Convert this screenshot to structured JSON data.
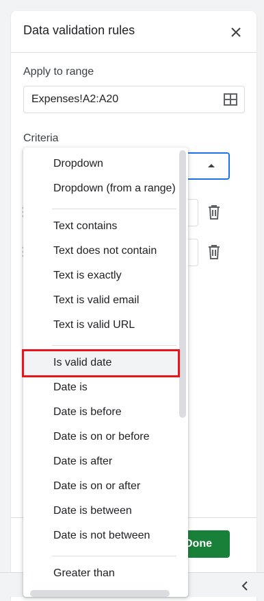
{
  "panel": {
    "title": "Data validation rules",
    "apply_to_range_label": "Apply to range",
    "range_value": "Expenses!A2:A20",
    "criteria_label": "Criteria",
    "done_label": "Done"
  },
  "menu": {
    "items": [
      {
        "label": "Dropdown"
      },
      {
        "label": "Dropdown (from a range)"
      },
      {
        "label": "Text contains"
      },
      {
        "label": "Text does not contain"
      },
      {
        "label": "Text is exactly"
      },
      {
        "label": "Text is valid email"
      },
      {
        "label": "Text is valid URL"
      },
      {
        "label": "Is valid date"
      },
      {
        "label": "Date is"
      },
      {
        "label": "Date is before"
      },
      {
        "label": "Date is on or before"
      },
      {
        "label": "Date is after"
      },
      {
        "label": "Date is on or after"
      },
      {
        "label": "Date is between"
      },
      {
        "label": "Date is not between"
      },
      {
        "label": "Greater than"
      }
    ],
    "selected": "Is valid date"
  },
  "colors": {
    "accent": "#1a73e8",
    "done_button": "#188038",
    "highlight_box": "#e8141c"
  }
}
